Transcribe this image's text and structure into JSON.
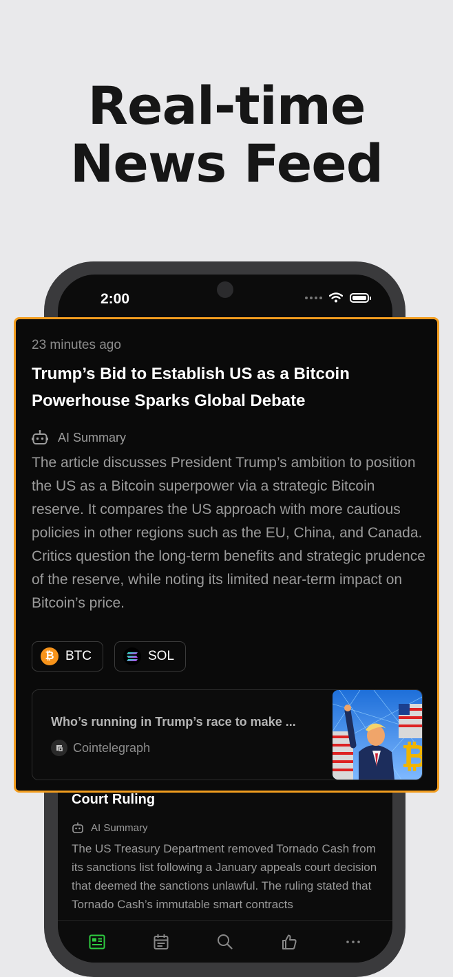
{
  "promo": {
    "headline_line1": "Real-time",
    "headline_line2": "News Feed"
  },
  "status_bar": {
    "time": "2:00",
    "icons": [
      "cellular-dots-icon",
      "wifi-icon",
      "battery-icon"
    ]
  },
  "featured_article": {
    "time_ago": "23 minutes ago",
    "title": "Trump’s Bid to Establish US as a Bitcoin Powerhouse Sparks Global Debate",
    "ai_label": "AI Summary",
    "summary": "The article discusses President Trump’s ambition to position the US as a Bitcoin superpower via a strategic Bitcoin reserve. It compares the US approach with more cautious policies in other regions such as the EU, China, and Canada. Critics question the long-term benefits and strategic prudence of the reserve, while noting its limited near-term impact on Bitcoin’s price.",
    "tags": [
      {
        "label": "BTC",
        "icon": "bitcoin-icon",
        "color": "#f7931a"
      },
      {
        "label": "SOL",
        "icon": "solana-icon",
        "color": "#9945ff"
      }
    ],
    "source": {
      "headline": "Who’s running in Trump’s race to make ...",
      "publisher": "Cointelegraph"
    }
  },
  "background_article": {
    "title": "Court Ruling",
    "ai_label": "AI Summary",
    "summary": "The US Treasury Department removed Tornado Cash from its sanctions list following a January appeals court decision that deemed the sanctions unlawful. The ruling stated that Tornado Cash’s immutable smart contracts"
  },
  "tab_bar": {
    "tabs": [
      {
        "icon": "news-icon",
        "active": true
      },
      {
        "icon": "calendar-icon",
        "active": false
      },
      {
        "icon": "search-icon",
        "active": false
      },
      {
        "icon": "thumbs-up-icon",
        "active": false
      },
      {
        "icon": "more-icon",
        "active": false
      }
    ]
  },
  "colors": {
    "accent_border": "#f29d1f",
    "active_tab": "#2ecc40",
    "background": "#e9e9eb"
  }
}
